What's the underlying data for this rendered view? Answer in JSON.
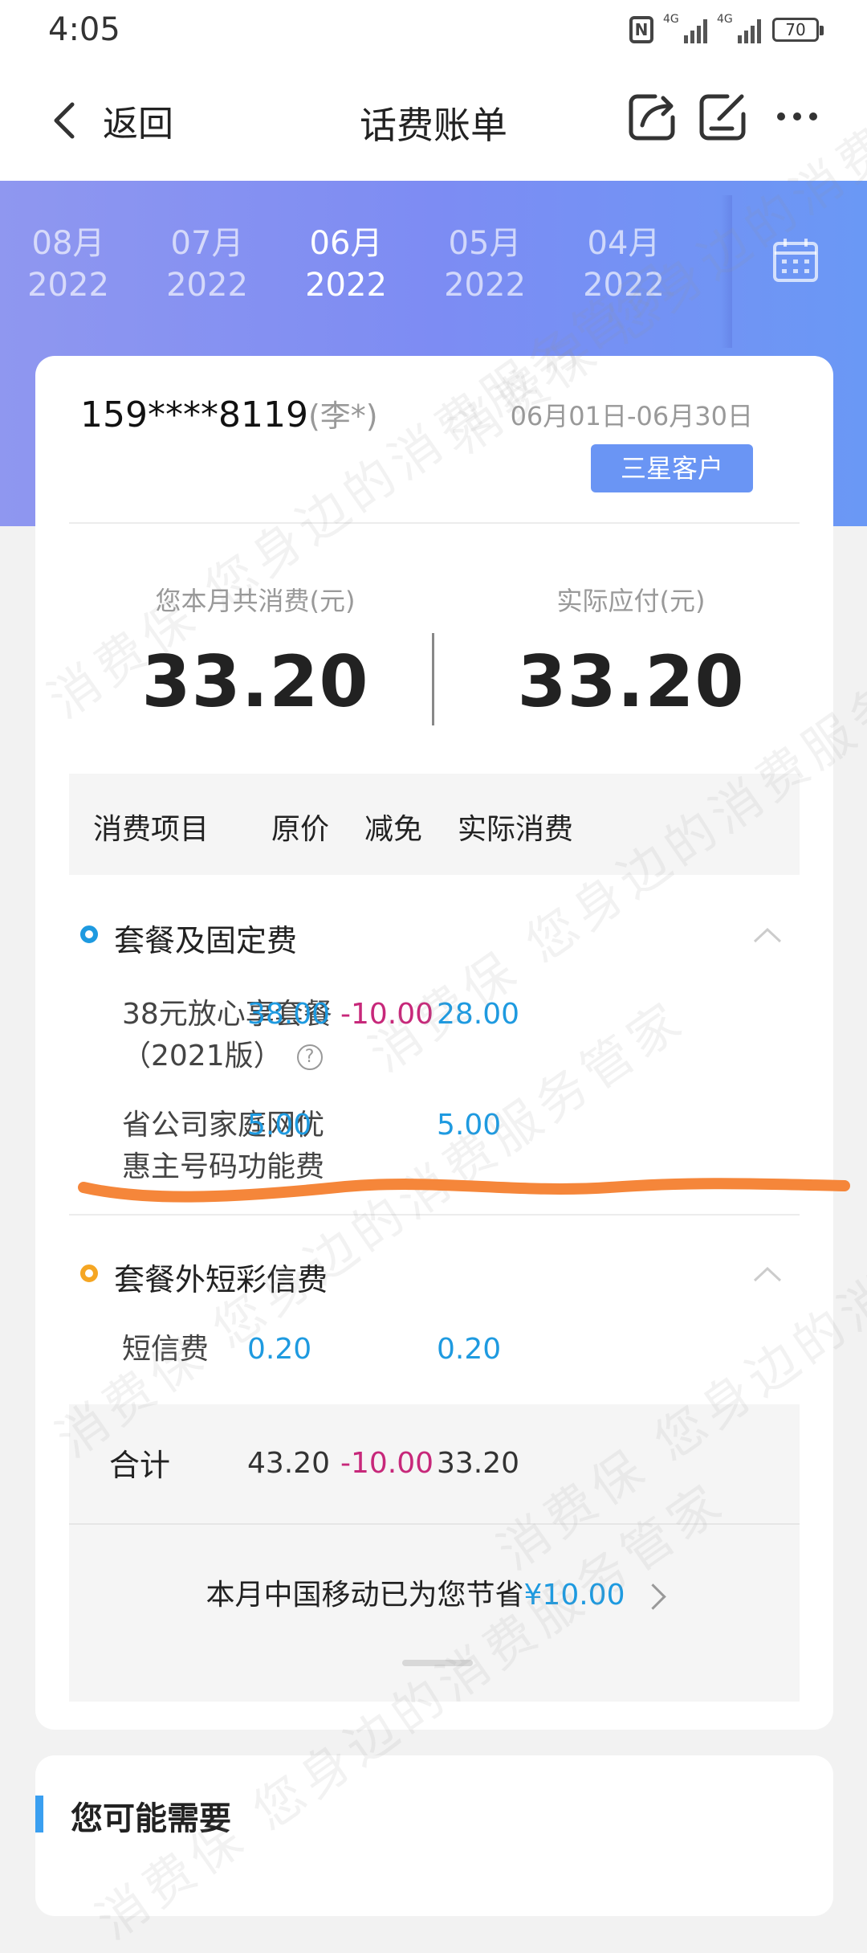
{
  "status_bar": {
    "time": "4:05",
    "battery": "70",
    "net1": "4G",
    "net2": "4G"
  },
  "header": {
    "back_label": "返回",
    "title": "话费账单"
  },
  "months": [
    {
      "month": "08月",
      "year": "2022"
    },
    {
      "month": "07月",
      "year": "2022"
    },
    {
      "month": "06月",
      "year": "2022",
      "active": true
    },
    {
      "month": "05月",
      "year": "2022"
    },
    {
      "month": "04月",
      "year": "2022"
    }
  ],
  "account": {
    "phone": "159****8119",
    "owner": "(李*)",
    "period": "06月01日-06月30日",
    "level": "三星客户"
  },
  "summary": {
    "total_label": "您本月共消费(元)",
    "total_value": "33.20",
    "payable_label": "实际应付(元)",
    "payable_value": "33.20"
  },
  "table": {
    "headers": [
      "消费项目",
      "原价",
      "减免",
      "实际消费"
    ],
    "sections": [
      {
        "title": "套餐及固定费",
        "dot_color": "#1e9ae0",
        "rows": [
          {
            "name_line1": "38元放心享套餐",
            "name_line2": "（2021版）",
            "original": "38.00",
            "discount": "-10.00",
            "actual": "28.00"
          },
          {
            "name_line1": "省公司家庭网优",
            "name_line2": "惠主号码功能费",
            "original": "5.00",
            "discount": "",
            "actual": "5.00"
          }
        ]
      },
      {
        "title": "套餐外短彩信费",
        "dot_color": "#f5a623",
        "rows": [
          {
            "name_line1": "短信费",
            "name_line2": "",
            "original": "0.20",
            "discount": "",
            "actual": "0.20"
          }
        ]
      }
    ],
    "total": {
      "label": "合计",
      "original": "43.20",
      "discount": "-10.00",
      "actual": "33.20"
    }
  },
  "saving": {
    "text": "本月中国移动已为您节省",
    "amount": "¥10.00"
  },
  "recommend": {
    "title": "您可能需要"
  },
  "watermark": "消费保 您身边的消费服务管家",
  "colors": {
    "accent_blue": "#1e9ae0",
    "discount_pink": "#c7287a",
    "annotation_orange": "#f5863a"
  }
}
